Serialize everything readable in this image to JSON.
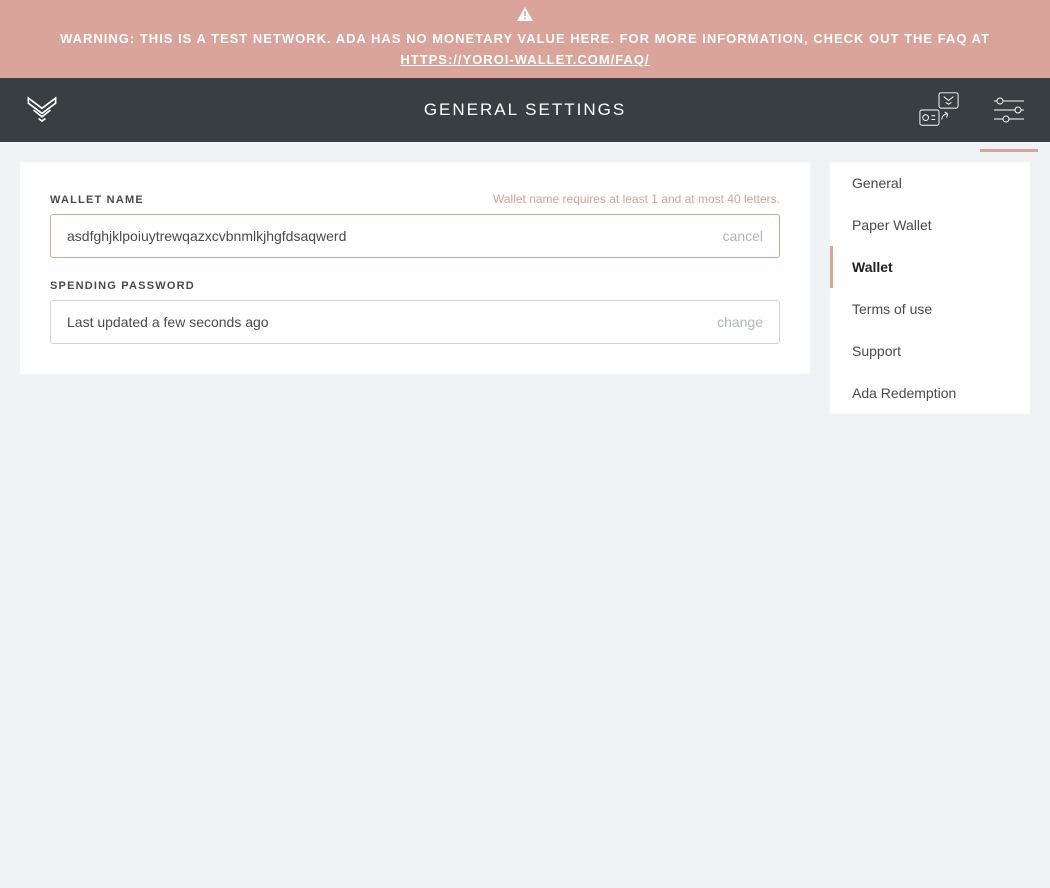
{
  "banner": {
    "text": "WARNING: THIS IS A TEST NETWORK. ADA HAS NO MONETARY VALUE HERE. FOR MORE INFORMATION, CHECK OUT THE FAQ AT",
    "link_text": "HTTPS://YOROI-WALLET.COM/FAQ/"
  },
  "header": {
    "title": "GENERAL SETTINGS"
  },
  "sidebar": {
    "items": [
      {
        "label": "General",
        "active": false
      },
      {
        "label": "Paper Wallet",
        "active": false
      },
      {
        "label": "Wallet",
        "active": true
      },
      {
        "label": "Terms of use",
        "active": false
      },
      {
        "label": "Support",
        "active": false
      },
      {
        "label": "Ada Redemption",
        "active": false
      }
    ]
  },
  "form": {
    "wallet_name": {
      "label": "WALLET NAME",
      "hint": "Wallet name requires at least 1 and at most 40 letters.",
      "value": "asdfghjklpoiuytrewqazxcvbnmlkjhgfdsaqwerd",
      "action": "cancel"
    },
    "password": {
      "label": "SPENDING PASSWORD",
      "value": "Last updated a few seconds ago",
      "action": "change"
    }
  },
  "colors": {
    "accent": "#daa49a",
    "header_bg": "#373f42",
    "page_bg": "#f0f3f5"
  }
}
